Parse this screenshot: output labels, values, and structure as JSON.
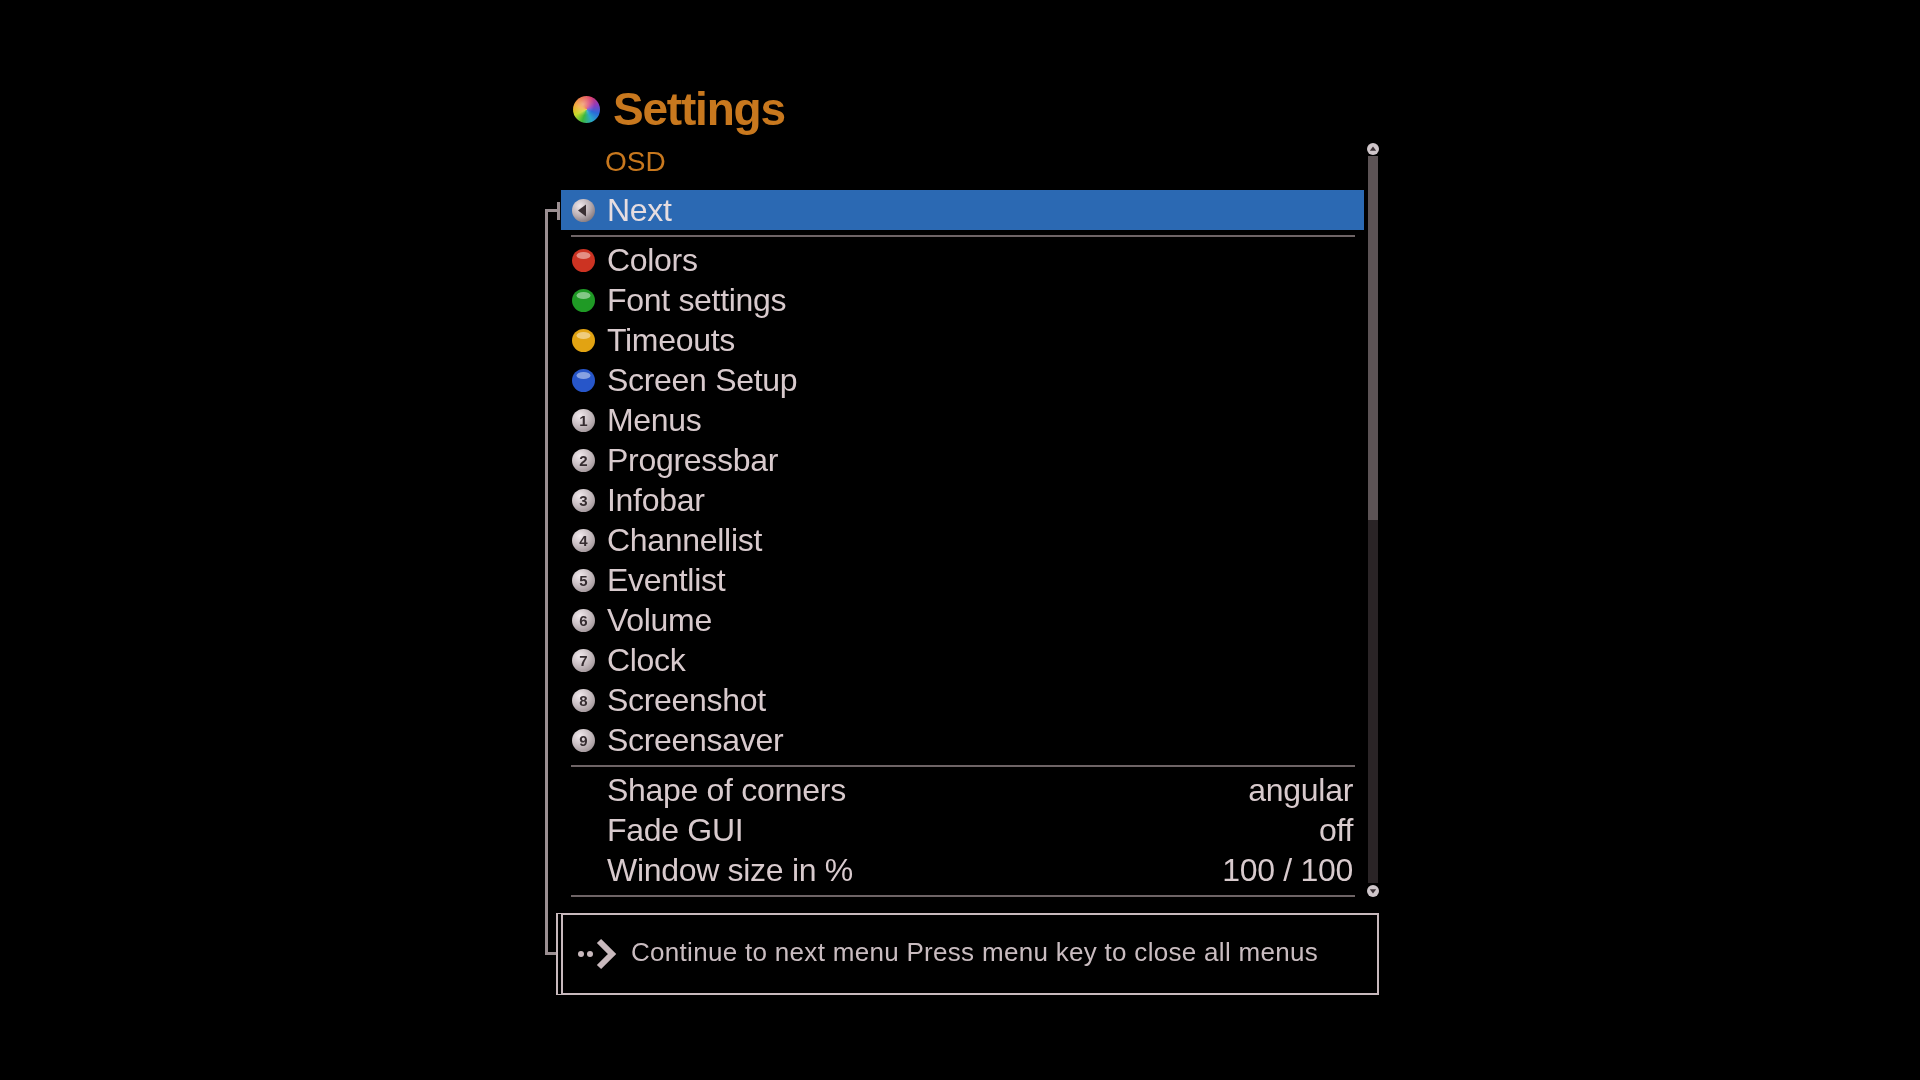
{
  "header": {
    "title": "Settings",
    "subtitle": "OSD"
  },
  "menu": {
    "sections": [
      {
        "items": [
          {
            "kind": "back",
            "label": "Next",
            "selected": true
          }
        ]
      },
      {
        "items": [
          {
            "kind": "color_key",
            "label": "Colors",
            "color": "#cc3322",
            "selected": false
          },
          {
            "kind": "color_key",
            "label": "Font settings",
            "color": "#1f9a25",
            "selected": false
          },
          {
            "kind": "color_key",
            "label": "Timeouts",
            "color": "#e2a312",
            "selected": false
          },
          {
            "kind": "color_key",
            "label": "Screen Setup",
            "color": "#2756c9",
            "selected": false
          },
          {
            "kind": "number_key",
            "key": "1",
            "label": "Menus",
            "selected": false
          },
          {
            "kind": "number_key",
            "key": "2",
            "label": "Progressbar",
            "selected": false
          },
          {
            "kind": "number_key",
            "key": "3",
            "label": "Infobar",
            "selected": false
          },
          {
            "kind": "number_key",
            "key": "4",
            "label": "Channellist",
            "selected": false
          },
          {
            "kind": "number_key",
            "key": "5",
            "label": "Eventlist",
            "selected": false
          },
          {
            "kind": "number_key",
            "key": "6",
            "label": "Volume",
            "selected": false
          },
          {
            "kind": "number_key",
            "key": "7",
            "label": "Clock",
            "selected": false
          },
          {
            "kind": "number_key",
            "key": "8",
            "label": "Screenshot",
            "selected": false
          },
          {
            "kind": "number_key",
            "key": "9",
            "label": "Screensaver",
            "selected": false
          }
        ]
      },
      {
        "items": [
          {
            "kind": "option",
            "label": "Shape of corners",
            "value": "angular",
            "selected": false
          },
          {
            "kind": "option",
            "label": "Fade GUI",
            "value": "off",
            "selected": false
          },
          {
            "kind": "option",
            "label": "Window size in %",
            "value": "100 / 100",
            "selected": false
          }
        ]
      }
    ]
  },
  "footer": {
    "hint": "Continue to next menu Press menu key to close all menus"
  }
}
